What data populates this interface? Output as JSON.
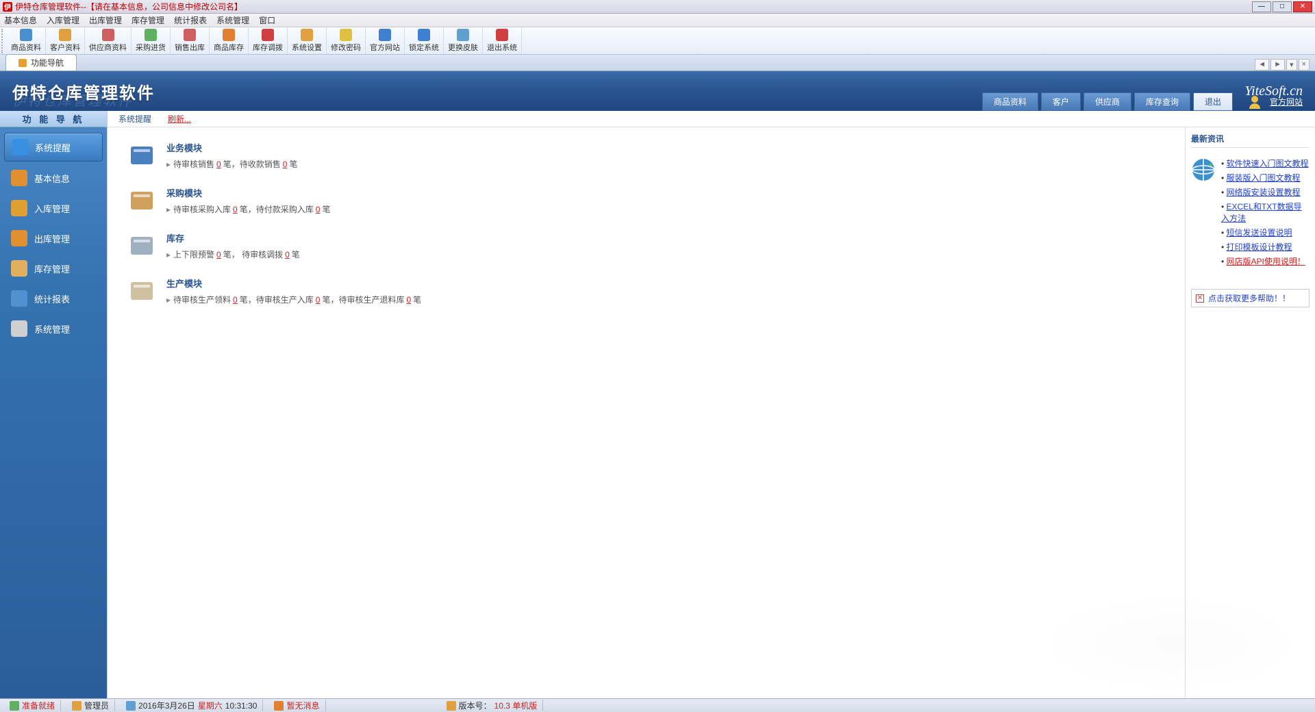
{
  "window": {
    "title": "伊特仓库管理软件--",
    "title_suffix": "【请在基本信息，公司信息中修改公司名】"
  },
  "menu": [
    "基本信息",
    "入库管理",
    "出库管理",
    "库存管理",
    "统计报表",
    "系统管理",
    "窗口"
  ],
  "toolbar": [
    {
      "label": "商品资料",
      "color": "#4a90d0"
    },
    {
      "label": "客户资料",
      "color": "#e0a040"
    },
    {
      "label": "供应商资料",
      "color": "#d06060"
    },
    {
      "label": "采购进货",
      "color": "#60b060"
    },
    {
      "label": "销售出库",
      "color": "#d06060"
    },
    {
      "label": "商品库存",
      "color": "#e08030"
    },
    {
      "label": "库存调拨",
      "color": "#d04040"
    },
    {
      "label": "系统设置",
      "color": "#e0a040"
    },
    {
      "label": "修改密码",
      "color": "#e0c040"
    },
    {
      "label": "官方网站",
      "color": "#4080d0"
    },
    {
      "label": "锁定系统",
      "color": "#4080d0"
    },
    {
      "label": "更换皮肤",
      "color": "#60a0d0"
    },
    {
      "label": "退出系统",
      "color": "#d04040"
    }
  ],
  "tab": {
    "label": "功能导航"
  },
  "banner": {
    "logo": "伊特仓库管理软件",
    "url": "YiteSoft.cn",
    "quick": [
      "商品资料",
      "客户",
      "供应商",
      "库存查询",
      "退出"
    ],
    "site_link": "官方网站"
  },
  "sidebar": {
    "title": "功 能 导 航",
    "items": [
      {
        "label": "系统提醒",
        "icon": "#3a90e0",
        "active": true
      },
      {
        "label": "基本信息",
        "icon": "#e09030"
      },
      {
        "label": "入库管理",
        "icon": "#e0a030"
      },
      {
        "label": "出库管理",
        "icon": "#e09030"
      },
      {
        "label": "库存管理",
        "icon": "#e0b060"
      },
      {
        "label": "统计报表",
        "icon": "#5090d0"
      },
      {
        "label": "系统管理",
        "icon": "#d0d0d0"
      }
    ]
  },
  "content_tabs": {
    "t1": "系统提醒",
    "refresh": "刷新..."
  },
  "modules": [
    {
      "title": "业务模块",
      "parts": [
        {
          "pre": "待审核销售",
          "cnt": "0",
          "post": " 笔，"
        },
        {
          "pre": "待收款销售",
          "cnt": "0",
          "post": "笔"
        }
      ]
    },
    {
      "title": "采购模块",
      "parts": [
        {
          "pre": "待审核采购入库",
          "cnt": "0",
          "post": " 笔，"
        },
        {
          "pre": "待付款采购入库",
          "cnt": "0",
          "post": "笔"
        }
      ]
    },
    {
      "title": "库存",
      "parts": [
        {
          "pre": "上下限预警",
          "cnt": "0",
          "post": "笔，"
        },
        {
          "pre": "  待审核调拨 ",
          "cnt": "0",
          "post": "笔"
        }
      ]
    },
    {
      "title": "生产模块",
      "parts": [
        {
          "pre": "待审核生产领料",
          "cnt": "0",
          "post": "笔，"
        },
        {
          "pre": "待审核生产入库",
          "cnt": "0",
          "post": "笔，"
        },
        {
          "pre": "待审核生产退料库",
          "cnt": "0",
          "post": "笔"
        }
      ]
    }
  ],
  "info": {
    "title": "最新资讯",
    "links": [
      {
        "text": "软件快速入门图文教程",
        "red": false
      },
      {
        "text": "服装版入门图文教程",
        "red": false
      },
      {
        "text": "网络版安装设置教程",
        "red": false
      },
      {
        "text": "EXCEL和TXT数据导入方法",
        "red": false
      },
      {
        "text": "短信发送设置说明",
        "red": false
      },
      {
        "text": "打印模板设计教程",
        "red": false
      },
      {
        "text": "网店版API使用说明！",
        "red": true
      }
    ],
    "help": "点击获取更多帮助！！"
  },
  "status": {
    "ready": "准备就绪",
    "user": "管理员",
    "date": "2016年3月26日",
    "weekday": "星期六",
    "time": "10:31:30",
    "msg": "暂无消息",
    "version_label": "版本号：",
    "version": "10.3 单机版"
  }
}
